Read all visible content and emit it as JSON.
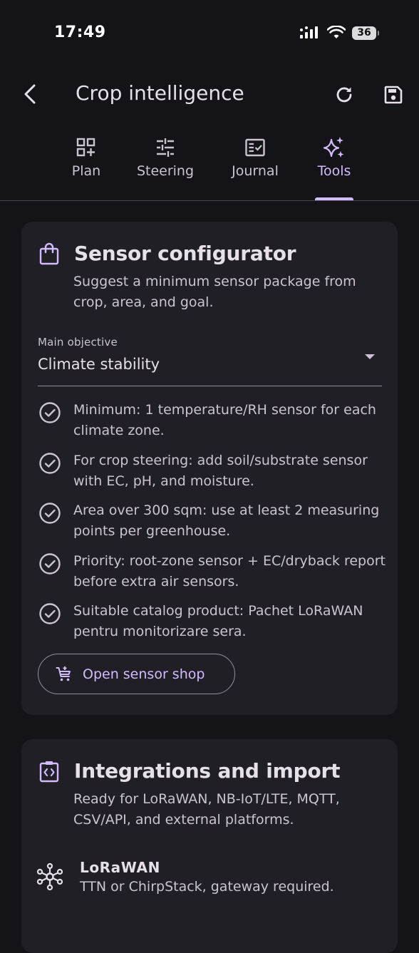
{
  "status": {
    "time": "17:49",
    "battery": "36"
  },
  "header": {
    "title": "Crop intelligence"
  },
  "tabs": [
    {
      "label": "Plan",
      "icon": "grid-add-icon",
      "active": false
    },
    {
      "label": "Steering",
      "icon": "sliders-icon",
      "active": false
    },
    {
      "label": "Journal",
      "icon": "journal-check-icon",
      "active": false
    },
    {
      "label": "Tools",
      "icon": "sparkles-icon",
      "active": true
    }
  ],
  "sensor_card": {
    "title": "Sensor configurator",
    "description": "Suggest a minimum sensor package from crop, area, and goal.",
    "select": {
      "label": "Main objective",
      "value": "Climate stability"
    },
    "items": [
      "Minimum: 1 temperature/RH sensor for each climate zone.",
      "For crop steering: add soil/substrate sensor with EC, pH, and moisture.",
      "Area over 300 sqm: use at least 2 measuring points per greenhouse.",
      "Priority: root-zone sensor + EC/dryback report before extra air sensors.",
      "Suitable catalog product: Pachet LoRaWAN pentru monitorizare sera."
    ],
    "button_label": "Open sensor shop"
  },
  "integrations_card": {
    "title": "Integrations and import",
    "description": "Ready for LoRaWAN, NB-IoT/LTE, MQTT, CSV/API, and external platforms.",
    "items": [
      {
        "title": "LoRaWAN",
        "description": "TTN or ChirpStack, gateway required."
      }
    ]
  },
  "colors": {
    "background": "#141318",
    "surface": "#211f26",
    "accent": "#d0bcff",
    "text": "#e6e1e9",
    "muted": "#cac4d0"
  }
}
